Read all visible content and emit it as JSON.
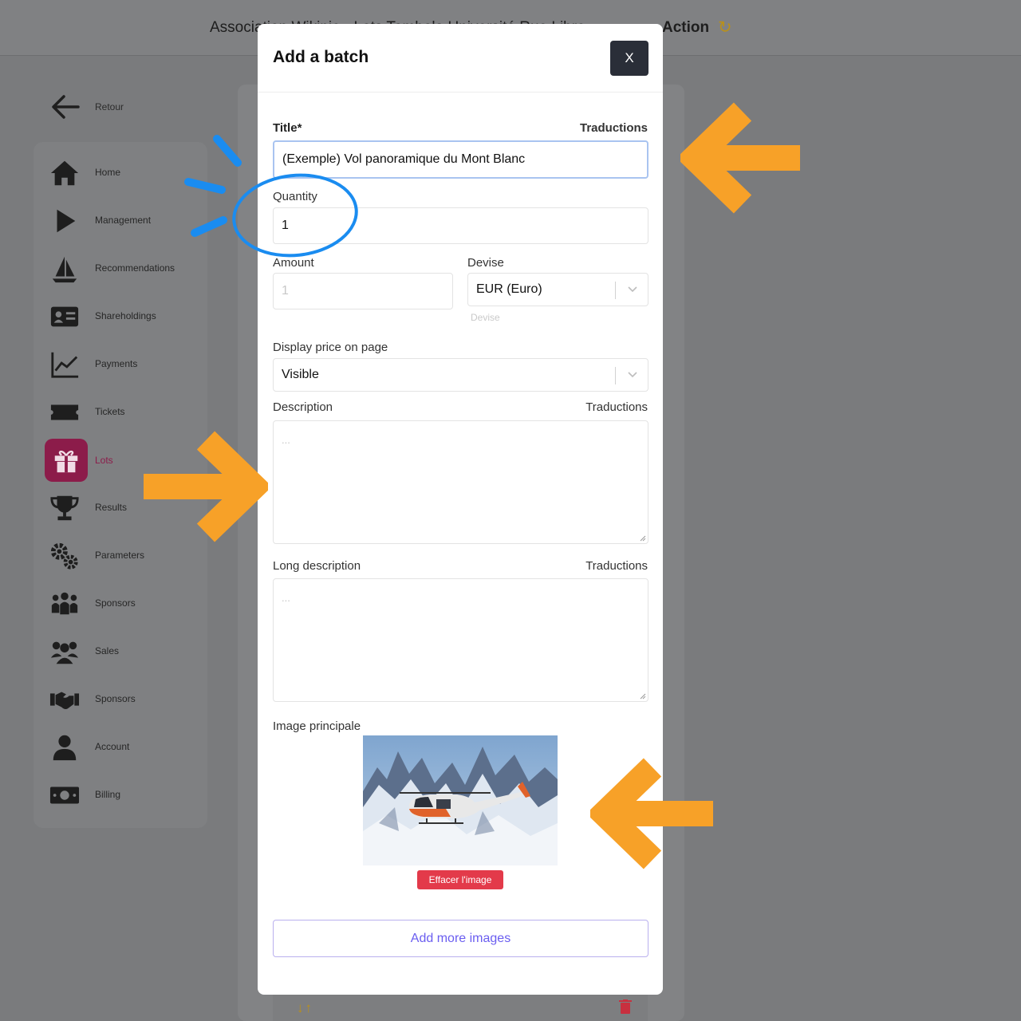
{
  "topbar": {
    "title": "Association Wikipie - Lots Tombola Université Rue Libre",
    "action_label": "Action",
    "refresh_icon": "refresh-icon"
  },
  "back": {
    "label": "Retour",
    "icon": "arrow-left-icon"
  },
  "sidebar": {
    "items": [
      {
        "label": "Home",
        "icon": "home-icon",
        "active": false
      },
      {
        "label": "Management",
        "icon": "play-icon",
        "active": false
      },
      {
        "label": "Recommendations",
        "icon": "ship-icon",
        "active": false
      },
      {
        "label": "Shareholdings",
        "icon": "id-card-icon",
        "active": false
      },
      {
        "label": "Payments",
        "icon": "chart-line-icon",
        "active": false
      },
      {
        "label": "Tickets",
        "icon": "ticket-icon",
        "active": false
      },
      {
        "label": "Lots",
        "icon": "gift-icon",
        "active": true
      },
      {
        "label": "Results",
        "icon": "trophy-icon",
        "active": false
      },
      {
        "label": "Parameters",
        "icon": "gears-icon",
        "active": false
      },
      {
        "label": "Sponsors",
        "icon": "people-group-icon",
        "active": false
      },
      {
        "label": "Sales",
        "icon": "users-icon",
        "active": false
      },
      {
        "label": "Sponsors",
        "icon": "handshake-icon",
        "active": false
      },
      {
        "label": "Account",
        "icon": "user-icon",
        "active": false
      },
      {
        "label": "Billing",
        "icon": "money-bill-icon",
        "active": false
      }
    ],
    "active_color": "#8c1c4a"
  },
  "modal": {
    "title": "Add a batch",
    "close_label": "X",
    "title_field": {
      "label": "Title*",
      "translations": "Traductions",
      "value": "(Exemple) Vol panoramique du Mont Blanc"
    },
    "quantity": {
      "label": "Quantity",
      "value": "1"
    },
    "amount": {
      "label": "Amount",
      "placeholder": "1"
    },
    "devise": {
      "label": "Devise",
      "value": "EUR (Euro)",
      "hint": "Devise"
    },
    "display_price": {
      "label": "Display price on page",
      "value": "Visible"
    },
    "description": {
      "label": "Description",
      "translations": "Traductions",
      "placeholder": "..."
    },
    "long_description": {
      "label": "Long description",
      "translations": "Traductions",
      "placeholder": "..."
    },
    "main_image": {
      "label": "Image principale",
      "delete_label": "Effacer l'image",
      "alt": "helicopter over snowy mountains"
    },
    "add_images_label": "Add more images"
  },
  "colors": {
    "annotation_arrow": "#f7a128",
    "annotation_circle": "#1a8cf0",
    "primary_link": "#6a5df0",
    "danger": "#e33a4a",
    "close_button": "#2a2e38"
  }
}
